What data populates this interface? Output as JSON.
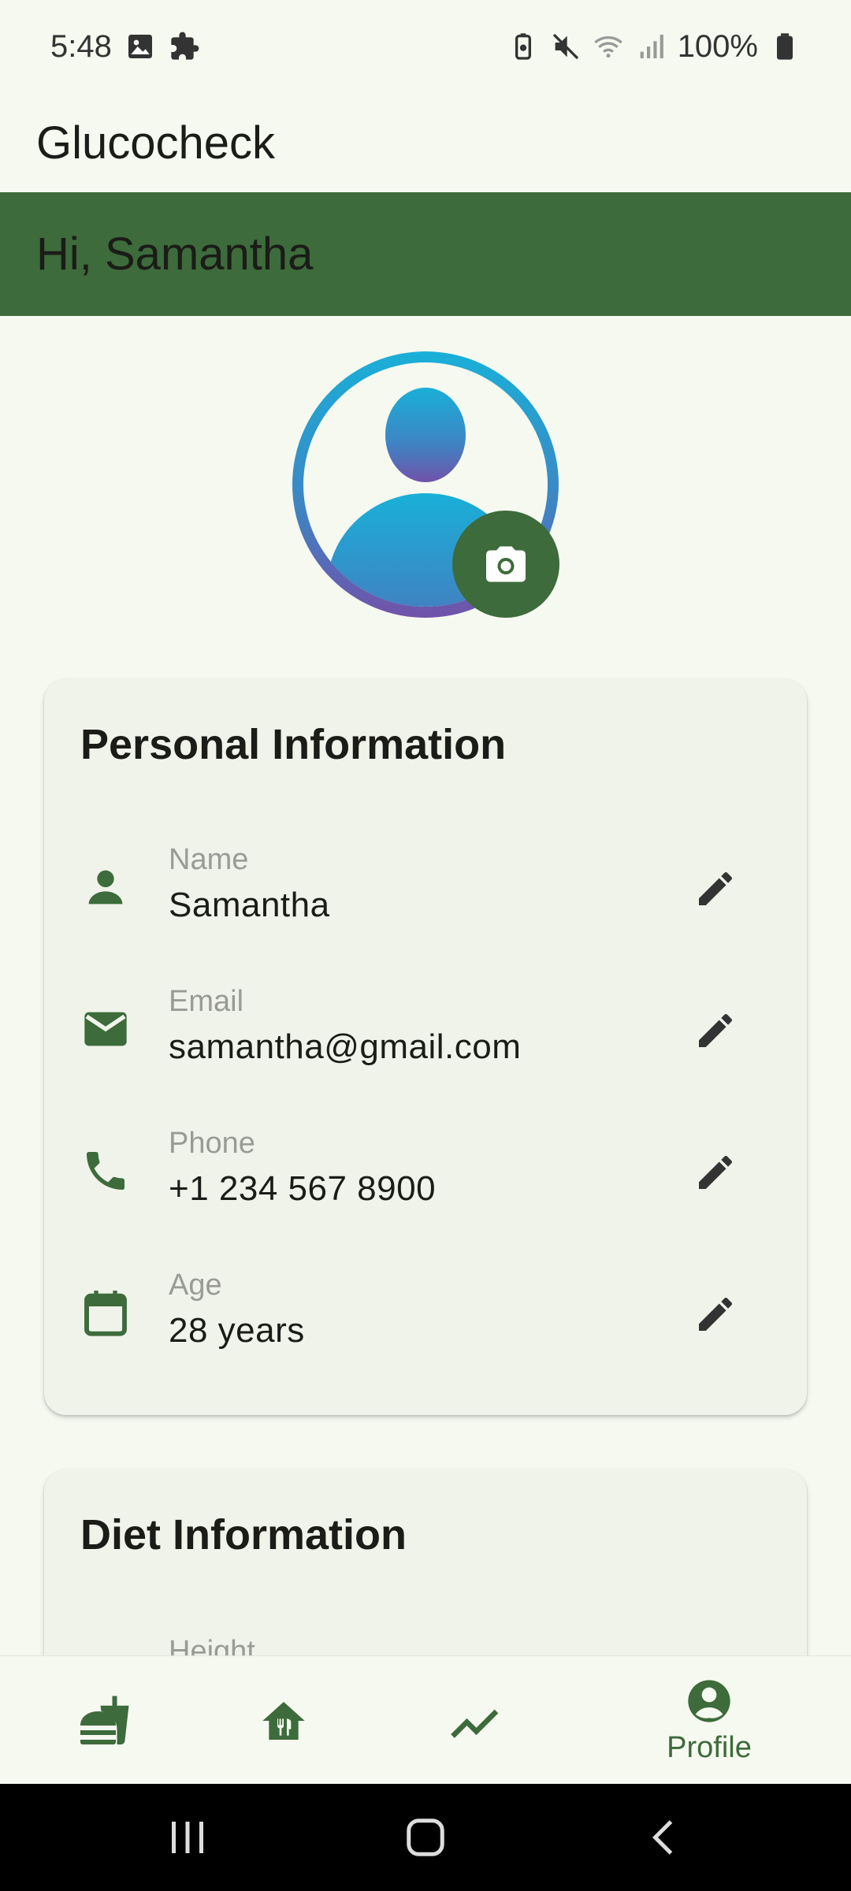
{
  "status_bar": {
    "time": "5:48",
    "battery": "100%",
    "left_icons": [
      "image-icon",
      "puzzle-icon"
    ],
    "right_icons": [
      "battery-saver-icon",
      "mute-icon",
      "wifi-icon",
      "signal-icon",
      "battery-icon"
    ]
  },
  "app_bar": {
    "title": "Glucocheck"
  },
  "greeting": {
    "text": "Hi, Samantha"
  },
  "personal": {
    "title": "Personal Information",
    "rows": [
      {
        "label": "Name",
        "value": "Samantha",
        "icon": "person-icon"
      },
      {
        "label": "Email",
        "value": "samantha@gmail.com",
        "icon": "mail-icon"
      },
      {
        "label": "Phone",
        "value": "+1 234 567 8900",
        "icon": "phone-icon"
      },
      {
        "label": "Age",
        "value": "28 years",
        "icon": "calendar-icon"
      }
    ]
  },
  "diet": {
    "title": "Diet Information",
    "rows": [
      {
        "label": "Height"
      }
    ]
  },
  "bottom_nav": {
    "items": [
      {
        "icon": "fastfood-icon",
        "label": ""
      },
      {
        "icon": "restaurant-home-icon",
        "label": ""
      },
      {
        "icon": "trending-icon",
        "label": ""
      },
      {
        "icon": "account-circle-icon",
        "label": "Profile",
        "active": true
      }
    ]
  },
  "colors": {
    "primary": "#3d6b3b",
    "background": "#f6f9f0",
    "card": "#f0f3ea",
    "label": "#9a9a96",
    "text": "#1b1c18"
  }
}
